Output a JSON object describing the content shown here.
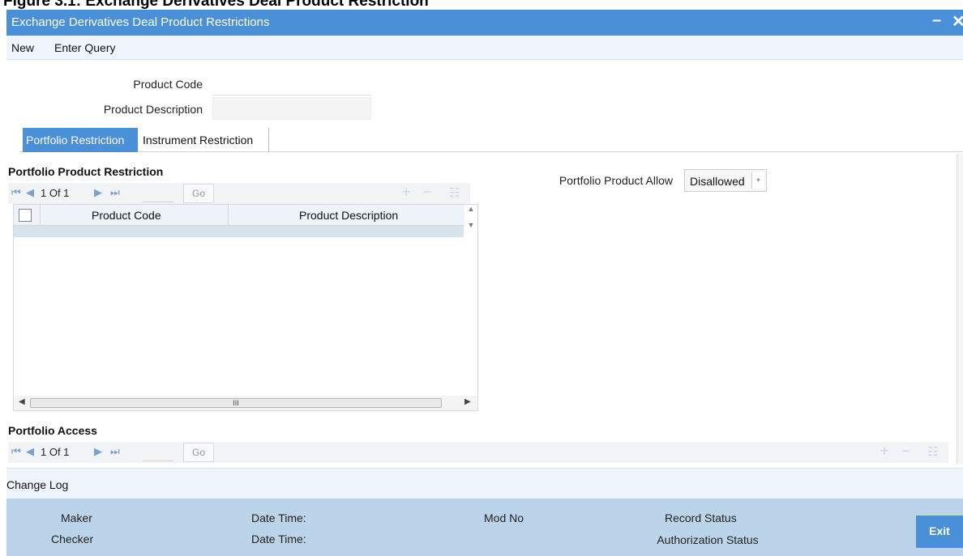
{
  "figure_caption": "Figure 3.1: Exchange Derivatives Deal Product Restriction",
  "window": {
    "title": "Exchange Derivatives Deal Product Restrictions",
    "minimize": "–",
    "close": "✕"
  },
  "menu": {
    "new": "New",
    "enter_query": "Enter Query"
  },
  "form": {
    "product_code_label": "Product Code",
    "product_code_value": "",
    "product_description_label": "Product Description",
    "product_description_value": ""
  },
  "tabs": [
    {
      "label": "Portfolio Restriction",
      "active": true
    },
    {
      "label": "Instrument Restriction",
      "active": false
    }
  ],
  "portfolio_product_restriction": {
    "title": "Portfolio Product Restriction",
    "pager": {
      "page_text": "1 Of 1",
      "go": "Go"
    },
    "columns": [
      "Product Code",
      "Product Description"
    ],
    "scroll_thumb": "III"
  },
  "portfolio_product_allow": {
    "label": "Portfolio Product Allow",
    "value": "Disallowed",
    "dropdown_arrow": "▾"
  },
  "portfolio_access": {
    "title": "Portfolio Access",
    "pager": {
      "page_text": "1 Of 1",
      "go": "Go"
    }
  },
  "change_log": "Change Log",
  "footer": {
    "maker": "Maker",
    "checker": "Checker",
    "date_time_1": "Date Time:",
    "date_time_2": "Date Time:",
    "mod_no": "Mod No",
    "record_status": "Record Status",
    "authorization_status": "Authorization Status",
    "exit": "Exit"
  },
  "colors": {
    "accent": "#4a90d9",
    "footer_bg": "#bcd4ea",
    "menu_bg": "#eef4fb"
  },
  "icons": [
    "first-page-icon",
    "prev-page-icon",
    "next-page-icon",
    "last-page-icon",
    "add-row-icon",
    "delete-row-icon",
    "single-view-icon"
  ]
}
